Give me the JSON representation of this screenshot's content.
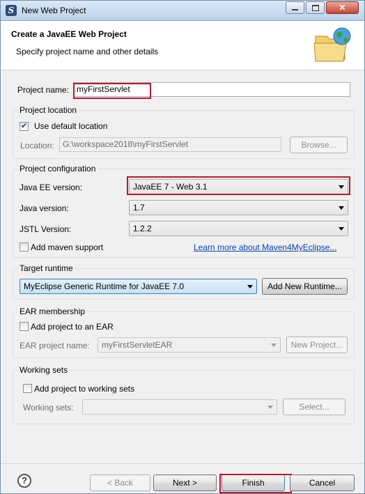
{
  "window": {
    "title": "New Web Project"
  },
  "header": {
    "title": "Create a JavaEE Web Project",
    "subtitle": "Specify project name and other details",
    "icon": "folder-globe-icon"
  },
  "project_name": {
    "label": "Project name:",
    "value": "myFirstServlet"
  },
  "project_location": {
    "group_label": "Project location",
    "use_default_label": "Use default location",
    "use_default_checked": true,
    "location_label": "Location:",
    "location_value": "G:\\workspace2018\\myFirstServlet",
    "browse_label": "Browse..."
  },
  "project_configuration": {
    "group_label": "Project configuration",
    "javaee_label": "Java EE version:",
    "javaee_value": "JavaEE 7 - Web 3.1",
    "java_label": "Java version:",
    "java_value": "1.7",
    "jstl_label": "JSTL Version:",
    "jstl_value": "1.2.2",
    "maven_label": "Add maven support",
    "maven_checked": false,
    "learn_more_link": "Learn more about Maven4MyEclipse..."
  },
  "target_runtime": {
    "group_label": "Target runtime",
    "runtime_value": "MyEclipse Generic Runtime for JavaEE 7.0",
    "add_runtime_label": "Add New Runtime..."
  },
  "ear_membership": {
    "group_label": "EAR membership",
    "add_to_ear_label": "Add project to an EAR",
    "add_to_ear_checked": false,
    "ear_name_label": "EAR project name:",
    "ear_name_value": "myFirstServletEAR",
    "new_project_label": "New Project..."
  },
  "working_sets": {
    "group_label": "Working sets",
    "add_label": "Add project to working sets",
    "add_checked": false,
    "sets_label": "Working sets:",
    "sets_value": "",
    "select_label": "Select..."
  },
  "footer": {
    "help_icon": "?",
    "back_label": "< Back",
    "next_label": "Next >",
    "finish_label": "Finish",
    "cancel_label": "Cancel"
  },
  "colors": {
    "highlight_border": "#c0152b",
    "link": "#0645ad"
  }
}
